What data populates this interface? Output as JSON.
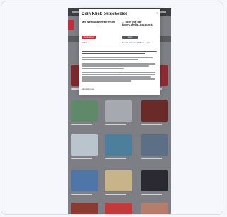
{
  "colors": {
    "accent": "#c92a35",
    "dark_button": "#55585d",
    "page_bg": "#f4f6fb"
  },
  "icons": [
    "close-icon"
  ],
  "consent_dialog": {
    "title": "Dein Klick entscheidet",
    "close_label": "×",
    "left_option": {
      "heading": "Mit Werbung weiterlesen",
      "button_label": "Zustimmen",
      "note": "Mehr"
    },
    "right_option": {
      "heading": "... oder mit der Ippen.Media-Accounts",
      "button_label": "Jetzt abonnieren",
      "note": "Du bist Abonnent? Zum Login"
    },
    "footer_link": "Einstellungen"
  }
}
